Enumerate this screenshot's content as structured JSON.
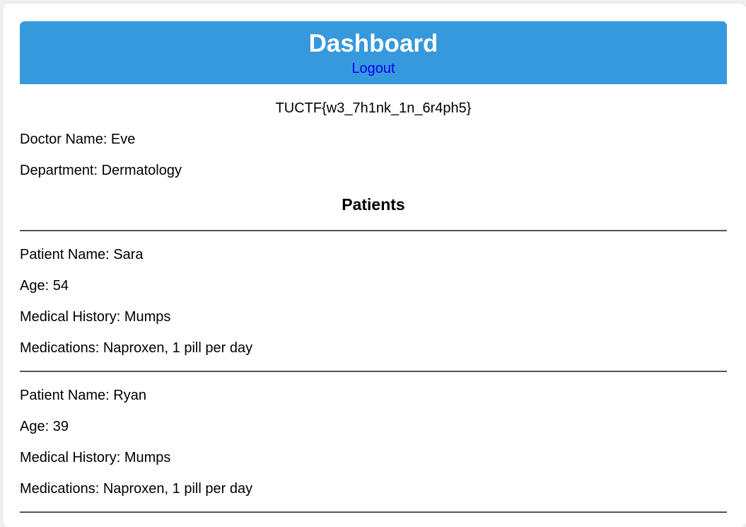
{
  "header": {
    "title": "Dashboard",
    "logout_label": "Logout"
  },
  "flag": "TUCTF{w3_7h1nk_1n_6r4ph5}",
  "doctor": {
    "name_line": "Doctor Name: Eve",
    "department_line": "Department: Dermatology"
  },
  "patients_heading": "Patients",
  "patients": [
    {
      "name_line": "Patient Name: Sara",
      "age_line": "Age: 54",
      "history_line": "Medical History: Mumps",
      "medications_line": "Medications: Naproxen, 1 pill per day"
    },
    {
      "name_line": "Patient Name: Ryan",
      "age_line": "Age: 39",
      "history_line": "Medical History: Mumps",
      "medications_line": "Medications: Naproxen, 1 pill per day"
    }
  ],
  "colors": {
    "header_bg": "#3799dd",
    "link": "#0000ee",
    "page_bg": "#f0f0f0"
  }
}
